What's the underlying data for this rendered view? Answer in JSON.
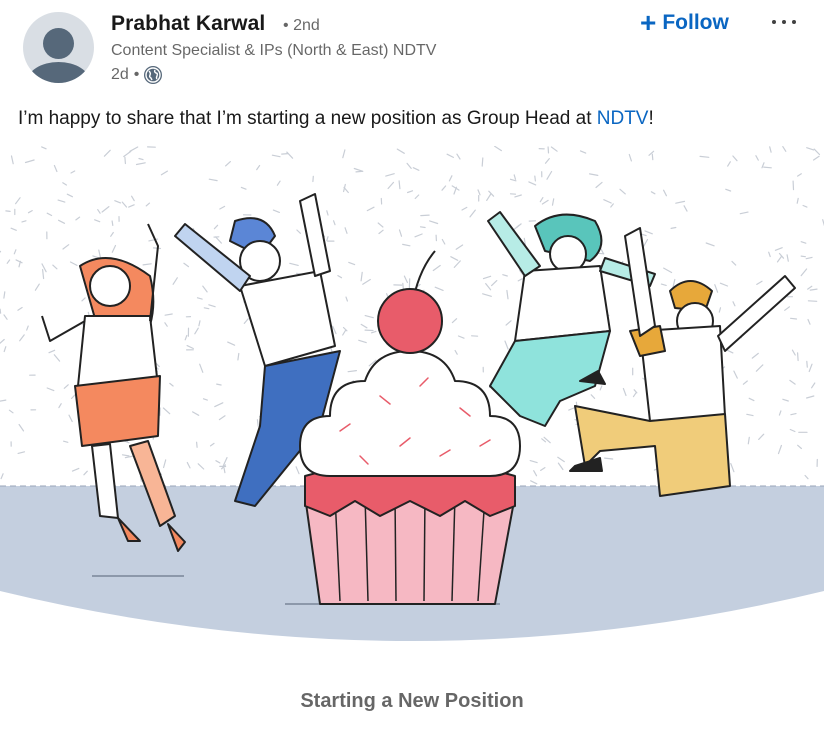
{
  "post": {
    "author": {
      "name": "Prabhat Karwal",
      "degree": "2nd",
      "headline": "Content Specialist & IPs (North & East) NDTV",
      "time": "2d",
      "separator": "•",
      "visibility_icon": "globe-icon"
    },
    "actions": {
      "follow_label": "Follow",
      "follow_icon": "plus-icon",
      "more_icon": "more-options-icon"
    },
    "text": {
      "prefix": "I’m happy to share that I’m starting a new position as Group Head at ",
      "link": "NDTV",
      "suffix": "!"
    },
    "image": {
      "caption": "Starting a New Position"
    }
  },
  "colors": {
    "brand": "#0a66c2",
    "floor": "#c4cfdf",
    "cherry": "#e85c6a",
    "frosting_base": "#e85c6a",
    "wrapper": "#f6b8c3",
    "person1_skirt": "#f4895f",
    "person2_pants": "#3f6fc0",
    "person3": "#8fe3dc",
    "person4_pants": "#e7a83a"
  }
}
